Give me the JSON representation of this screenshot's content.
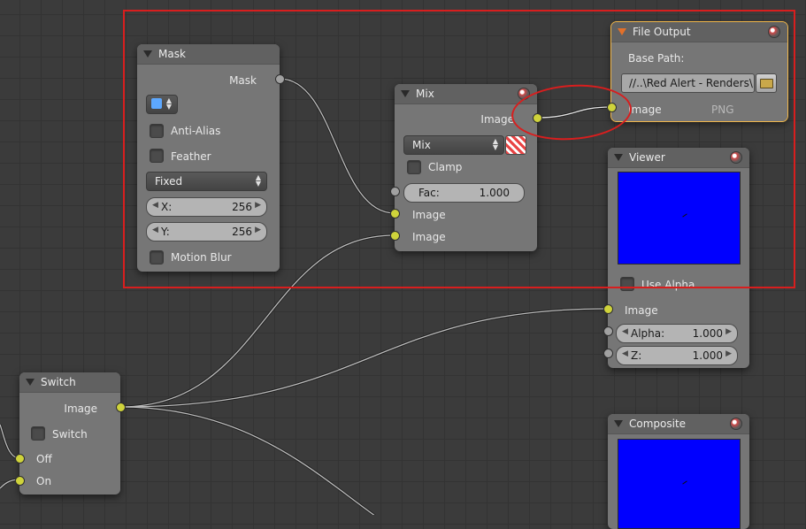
{
  "nodes": {
    "mask": {
      "title": "Mask",
      "output": "Mask",
      "anti_alias": "Anti-Alias",
      "feather": "Feather",
      "size_mode": "Fixed",
      "x_label": "X:",
      "x_value": "256",
      "y_label": "Y:",
      "y_value": "256",
      "motion_blur": "Motion Blur",
      "mask_icon": "mask-datablock-icon"
    },
    "mix": {
      "title": "Mix",
      "output": "Image",
      "blend_mode": "Mix",
      "clamp": "Clamp",
      "fac_label": "Fac:",
      "fac_value": "1.000",
      "input1": "Image",
      "input2": "Image"
    },
    "file_output": {
      "title": "File Output",
      "base_path_label": "Base Path:",
      "base_path": "//..\\Red Alert - Renders\\",
      "input": "Image",
      "format": "PNG"
    },
    "viewer": {
      "title": "Viewer",
      "use_alpha": "Use Alpha",
      "input": "Image",
      "alpha_label": "Alpha:",
      "alpha_value": "1.000",
      "z_label": "Z:",
      "z_value": "1.000",
      "preview_color": "#0000ff"
    },
    "switch": {
      "title": "Switch",
      "output": "Image",
      "switch_label": "Switch",
      "off": "Off",
      "on": "On"
    },
    "composite": {
      "title": "Composite",
      "preview_color": "#0000ff"
    }
  },
  "colors": {
    "socket_color": "#cfd33b",
    "annotation": "#d81e1e",
    "active_outline": "#f0b64a"
  }
}
